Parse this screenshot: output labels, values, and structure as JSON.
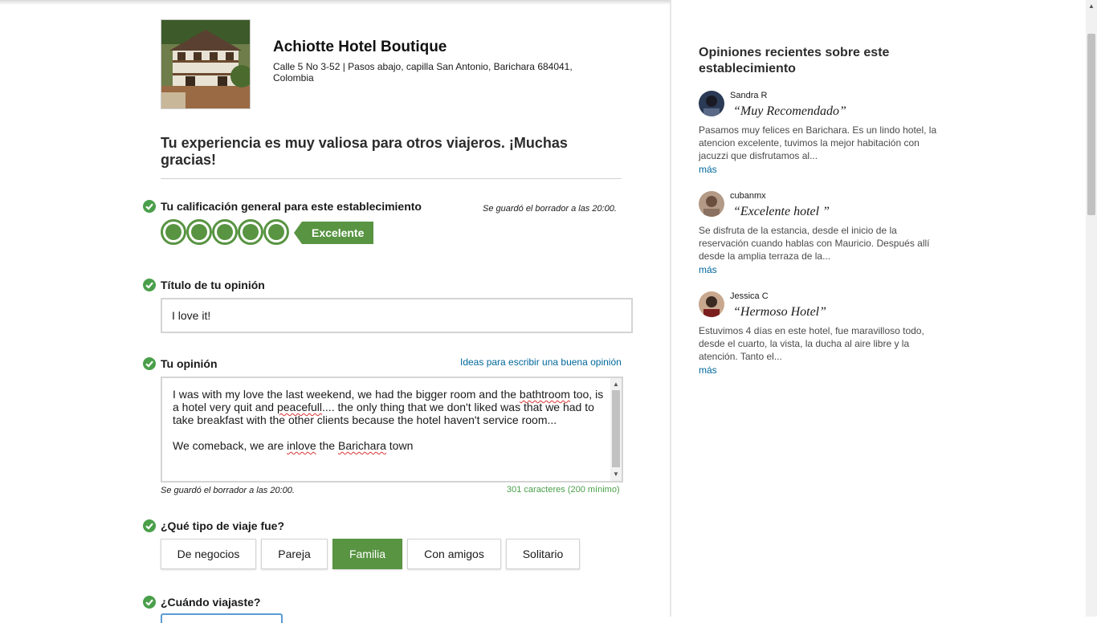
{
  "hotel": {
    "name": "Achiotte Hotel Boutique",
    "address": "Calle 5 No 3-52 | Pasos abajo, capilla San Antonio, Barichara 684041, Colombia"
  },
  "thanks_message": "Tu experiencia es muy valiosa para otros viajeros. ¡Muchas gracias!",
  "overall_rating": {
    "label": "Tu calificación general para este establecimiento",
    "draft_note": "Se guardó el borrador a las 20:00.",
    "value": 5,
    "max": 5,
    "text": "Excelente"
  },
  "review_title": {
    "label": "Título de tu opinión",
    "value": "I love it!"
  },
  "review": {
    "label": "Tu opinión",
    "ideas_link": "Ideas para escribir una buena opinión",
    "paragraph1_a": "I was with my love the last weekend, we had the bigger room and the ",
    "paragraph1_b": "bathtroom",
    "paragraph1_c": " too, is a hotel very quit and ",
    "paragraph1_d": "peacefull",
    "paragraph1_e": ".... the only thing that we don't liked was that we had to take breakfast with the other clients because the hotel haven't service room...",
    "paragraph2_a": "We comeback, we are ",
    "paragraph2_b": "inlove",
    "paragraph2_c": " the ",
    "paragraph2_d": "Barichara",
    "paragraph2_e": " town",
    "draft_note": "Se guardó el borrador a las 20:00.",
    "char_count": "301 caracteres (200 mínimo)"
  },
  "trip_type": {
    "label": "¿Qué tipo de viaje fue?",
    "options": [
      "De negocios",
      "Pareja",
      "Familia",
      "Con amigos",
      "Solitario"
    ],
    "selected": "Familia"
  },
  "when": {
    "label": "¿Cuándo viajaste?"
  },
  "sidebar": {
    "title": "Opiniones recientes sobre este establecimiento",
    "reviews": [
      {
        "user": "Sandra R",
        "title": "“Muy Recomendado”",
        "body": "Pasamos muy felices en Barichara. Es un lindo hotel, la atencion excelente, tuvimos la mejor habitación con jacuzzi que disfrutamos al...",
        "more": "más"
      },
      {
        "user": "cubanmx",
        "title": "“Excelente hotel ”",
        "body": "Se disfruta de la estancia, desde el inicio de la reservación cuando hablas con Mauricio. Después allí desde la amplia terraza de la...",
        "more": "más"
      },
      {
        "user": "Jessica C",
        "title": "“Hermoso Hotel”",
        "body": "Estuvimos 4 días en este hotel, fue maravilloso todo, desde el cuarto, la vista, la ducha al aire libre y la atención. Tanto el...",
        "more": "más"
      }
    ]
  },
  "colors": {
    "brand_green": "#589442",
    "check_green": "#4a9f4a",
    "link_blue": "#00679a"
  }
}
